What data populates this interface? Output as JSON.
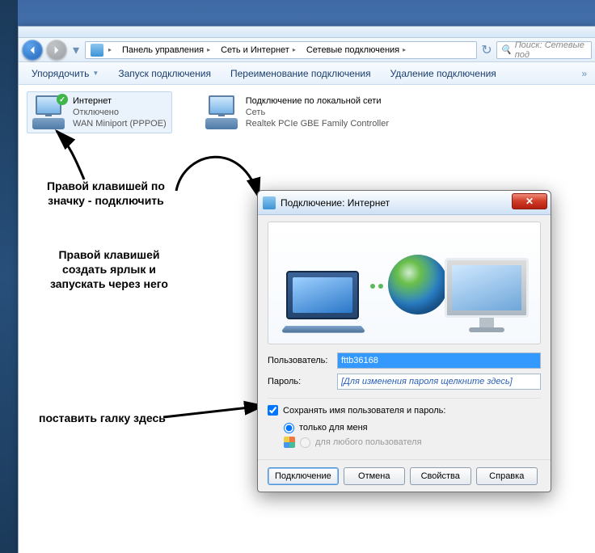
{
  "breadcrumb": {
    "root_icon": "control-panel-icon",
    "items": [
      "Панель управления",
      "Сеть и Интернет",
      "Сетевые подключения"
    ]
  },
  "search": {
    "placeholder": "Поиск: Сетевые под"
  },
  "toolbar": {
    "items": [
      "Упорядочить",
      "Запуск подключения",
      "Переименование подключения",
      "Удаление подключения"
    ],
    "overflow": "»"
  },
  "connections": [
    {
      "name": "Интернет",
      "status": "Отключено",
      "device": "WAN Miniport (PPPOE)",
      "selected": true,
      "badge": "check"
    },
    {
      "name": "Подключение по локальной сети",
      "status": "Сеть",
      "device": "Realtek PCIe GBE Family Controller",
      "selected": false,
      "badge": ""
    }
  ],
  "annotations": {
    "a1": "Правой клавишей по\nзначку - подключить",
    "a2": "Правой клавишей\nсоздать ярлык и\nзапускать через него",
    "a3": "поставить галку здесь"
  },
  "dialog": {
    "title": "Подключение: Интернет",
    "user_label": "Пользователь:",
    "user_value": "fttb36168",
    "pass_label": "Пароль:",
    "pass_placeholder": "[Для изменения пароля щелкните здесь]",
    "save_label": "Сохранять имя пользователя и пароль:",
    "radio_me": "только для меня",
    "radio_all": "для любого пользователя",
    "buttons": {
      "connect": "Подключение",
      "cancel": "Отмена",
      "props": "Свойства",
      "help": "Справка"
    }
  }
}
